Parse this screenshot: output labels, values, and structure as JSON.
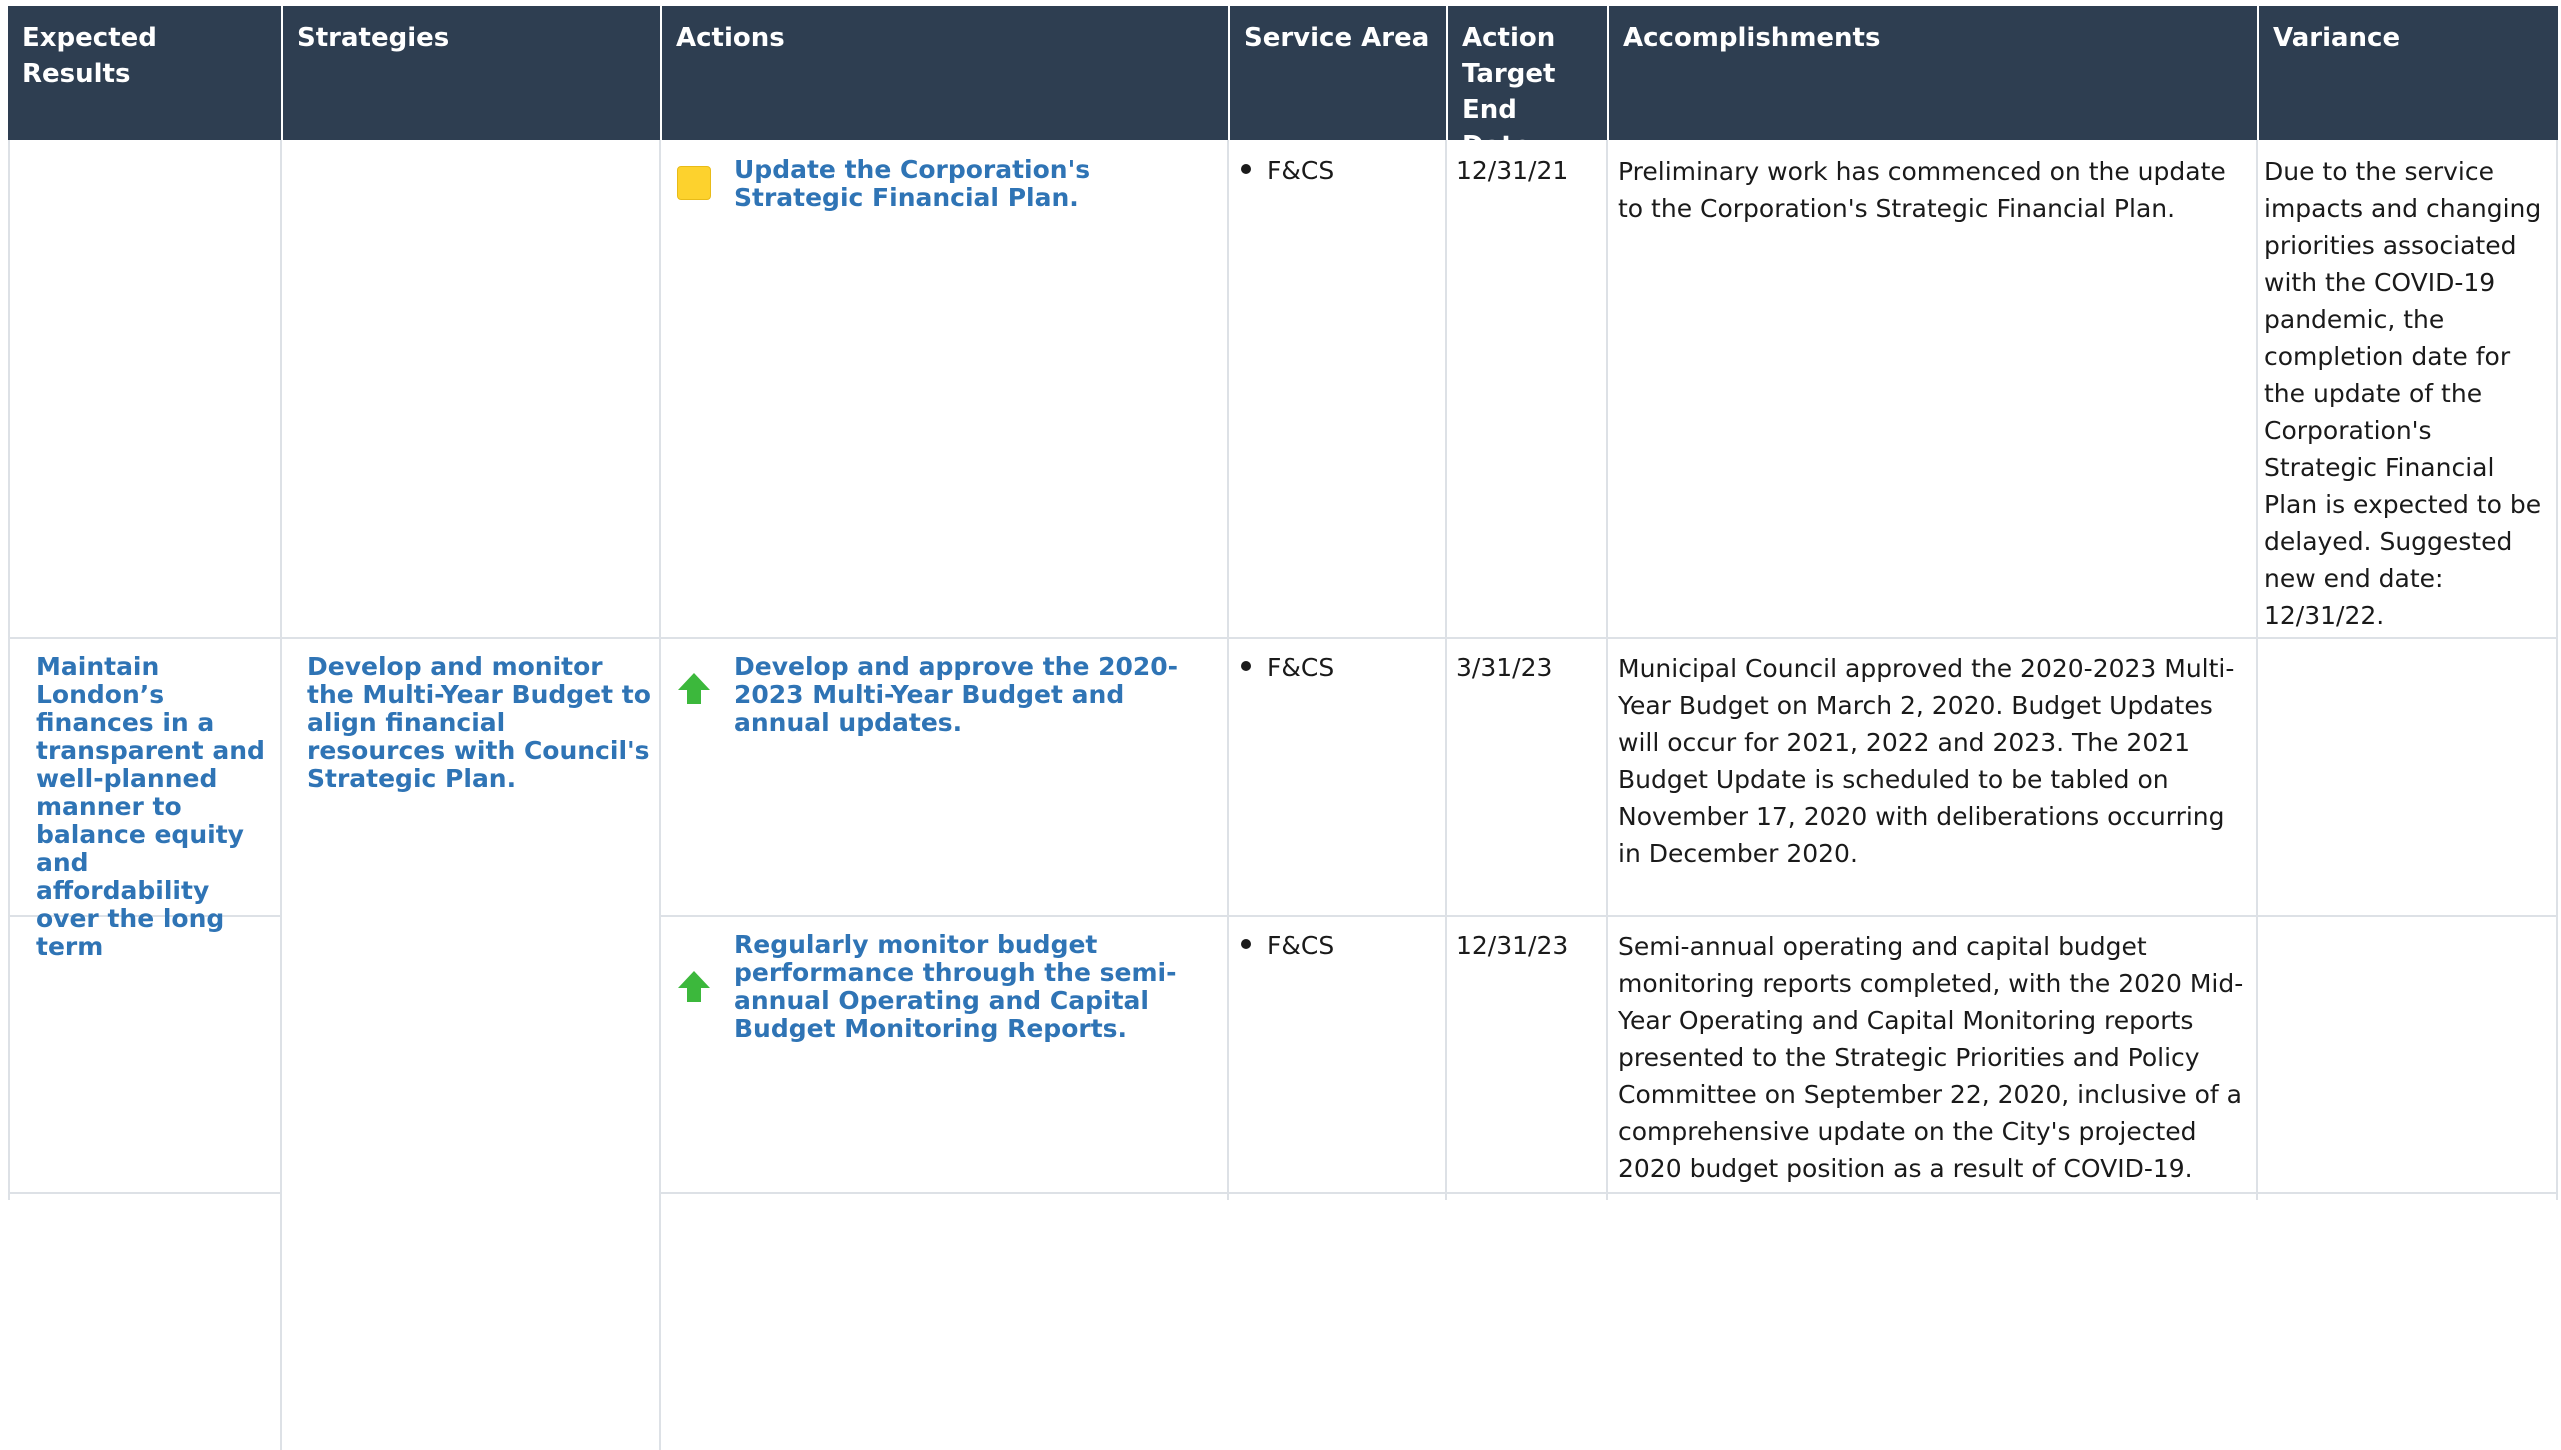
{
  "headers": {
    "expected": "Expected Results",
    "strategies": "Strategies",
    "actions": "Actions",
    "service": "Service Area",
    "target": "Action Target End Date",
    "accomplishments": "Accomplishments",
    "variance": "Variance"
  },
  "expected_result": "Maintain London’s finances in a transparent and well-planned manner to balance equity and affordability over the long term",
  "strategy": "Develop and monitor the Multi-Year Budget to align financial resources with Council's Strategic Plan.",
  "colors": {
    "header_bg": "#2e3e51",
    "link": "#2f74b5",
    "status_caution": "#fdd22d",
    "status_on_track": "#3cb83c"
  },
  "rows": [
    {
      "status_icon": "caution-square-icon",
      "action": "Update the Corporation's Strategic Financial Plan.",
      "service_area": "F&CS",
      "target_date": "12/31/21",
      "accomplishment": "Preliminary work has commenced on the update to the Corporation's Strategic Financial Plan.",
      "variance": "Due to the service impacts and changing priorities associated with the COVID-19 pandemic, the completion date for the update of the Corporation's Strategic Financial Plan is expected to be delayed. Suggested new end date: 12/31/22."
    },
    {
      "status_icon": "on-track-arrow-icon",
      "action": "Develop and approve the 2020-2023 Multi-Year Budget and annual updates.",
      "service_area": "F&CS",
      "target_date": "3/31/23",
      "accomplishment": "Municipal Council approved the 2020-2023 Multi-Year Budget on March 2, 2020. Budget Updates will occur for 2021, 2022 and 2023.  The 2021 Budget Update is scheduled to be tabled on November 17, 2020 with deliberations occurring in December 2020.",
      "variance": ""
    },
    {
      "status_icon": "on-track-arrow-icon",
      "action": "Regularly monitor budget performance through the semi-annual Operating and Capital Budget Monitoring Reports.",
      "service_area": "F&CS",
      "target_date": "12/31/23",
      "accomplishment": "Semi-annual operating and capital budget monitoring reports completed, with the 2020 Mid-Year Operating and Capital Monitoring reports presented to the Strategic Priorities and Policy Committee on September 22, 2020, inclusive of a comprehensive update on the City's projected 2020 budget position as a result of COVID-19.",
      "variance": ""
    }
  ]
}
